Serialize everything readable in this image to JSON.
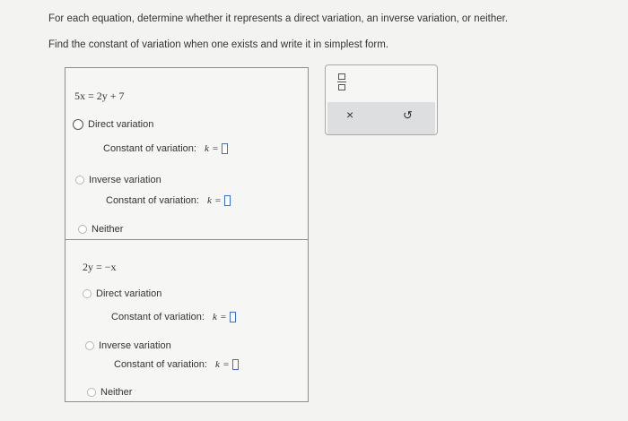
{
  "instructions": {
    "line1": "For each equation, determine whether it represents a direct variation, an inverse variation, or neither.",
    "line2": "Find the constant of variation when one exists and write it in simplest form."
  },
  "questions": [
    {
      "equation": "5x = 2y + 7",
      "direct_label": "Direct variation",
      "inverse_label": "Inverse variation",
      "neither_label": "Neither",
      "constant_label": "Constant of variation:",
      "k_label": "k",
      "equals": "="
    },
    {
      "equation": "2y = −x",
      "direct_label": "Direct variation",
      "inverse_label": "Inverse variation",
      "neither_label": "Neither",
      "constant_label": "Constant of variation:",
      "k_label": "k",
      "equals": "="
    }
  ],
  "toolbar": {
    "fraction_icon": "fraction-icon",
    "clear_symbol": "×",
    "undo_symbol": "↺"
  },
  "colors": {
    "answer_box_border": "#3d6fd0",
    "toolbar_strip": "#dcdedf"
  }
}
